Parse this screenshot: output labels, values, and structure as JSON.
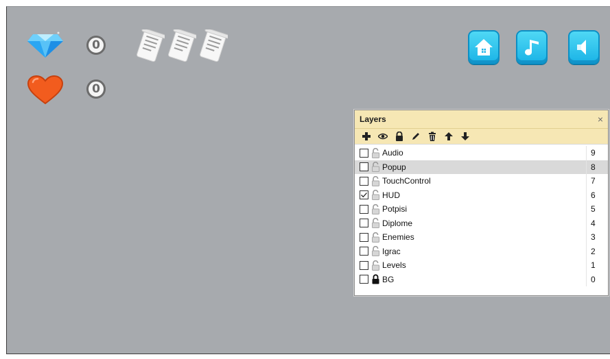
{
  "hud": {
    "gem_count": "0",
    "heart_count": "0",
    "diplomas": [
      "diploma-icon",
      "diploma-icon",
      "diploma-icon"
    ],
    "gem_color": "#2aa6f2",
    "heart_color": "#f25c1e",
    "buttons": [
      "home-icon",
      "music-icon",
      "sound-icon"
    ],
    "button_color": "#2bc6ef"
  },
  "layers_panel": {
    "title": "Layers",
    "close_glyph": "×",
    "header_color": "#f6e7b4",
    "toolbar": [
      "add-icon",
      "eye-icon",
      "lock-icon",
      "pencil-icon",
      "trash-icon",
      "arrow-up-icon",
      "arrow-down-icon"
    ],
    "layers": [
      {
        "name": "Audio",
        "order": "9",
        "visible": false,
        "locked": false,
        "selected": false
      },
      {
        "name": "Popup",
        "order": "8",
        "visible": false,
        "locked": false,
        "selected": true
      },
      {
        "name": "TouchControl",
        "order": "7",
        "visible": false,
        "locked": false,
        "selected": false
      },
      {
        "name": "HUD",
        "order": "6",
        "visible": true,
        "locked": false,
        "selected": false
      },
      {
        "name": "Potpisi",
        "order": "5",
        "visible": false,
        "locked": false,
        "selected": false
      },
      {
        "name": "Diplome",
        "order": "4",
        "visible": false,
        "locked": false,
        "selected": false
      },
      {
        "name": "Enemies",
        "order": "3",
        "visible": false,
        "locked": false,
        "selected": false
      },
      {
        "name": "Igrac",
        "order": "2",
        "visible": false,
        "locked": false,
        "selected": false
      },
      {
        "name": "Levels",
        "order": "1",
        "visible": false,
        "locked": false,
        "selected": false
      },
      {
        "name": "BG",
        "order": "0",
        "visible": false,
        "locked": true,
        "selected": false
      }
    ]
  }
}
